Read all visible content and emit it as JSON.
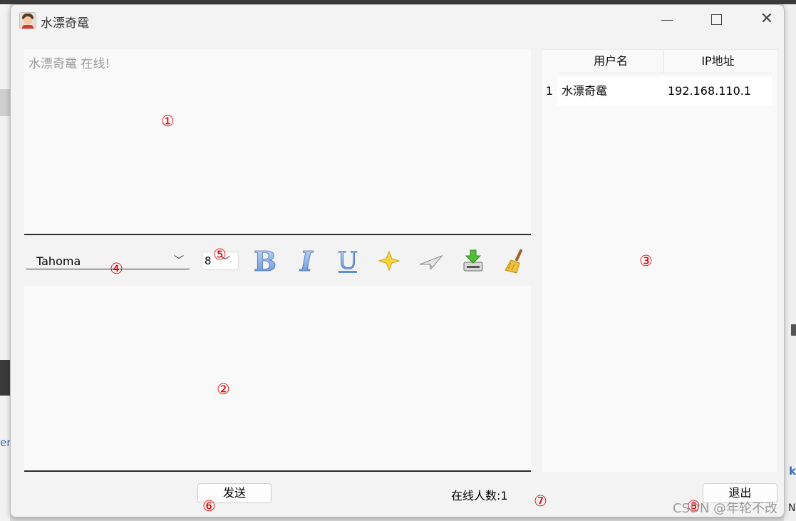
{
  "window": {
    "title": "水漂奇鼋"
  },
  "chat": {
    "messages": [
      "水漂奇鼋 在线!"
    ]
  },
  "toolbar": {
    "font_family": "Tahoma",
    "font_size": "8",
    "tools": [
      {
        "icon": "bold-icon"
      },
      {
        "icon": "italic-icon"
      },
      {
        "icon": "underline-icon"
      },
      {
        "icon": "color-star-icon"
      },
      {
        "icon": "send-file-plane-icon"
      },
      {
        "icon": "save-download-icon"
      },
      {
        "icon": "clear-broom-icon"
      }
    ]
  },
  "users": {
    "columns": [
      "用户名",
      "IP地址"
    ],
    "rows": [
      {
        "index": "1",
        "name": "水漂奇鼋",
        "ip": "192.168.110.1"
      }
    ]
  },
  "footer": {
    "send_label": "发送",
    "online_label": "在线人数:1",
    "exit_label": "退出"
  },
  "annotations": [
    "①",
    "②",
    "③",
    "④",
    "⑤",
    "⑥",
    "⑦",
    "⑧"
  ],
  "watermark": "CSDN @年轮不改",
  "colors": {
    "annotation": "#e00000",
    "panel_bg": "#f9f9f9",
    "window_bg": "#f3f3f3"
  }
}
